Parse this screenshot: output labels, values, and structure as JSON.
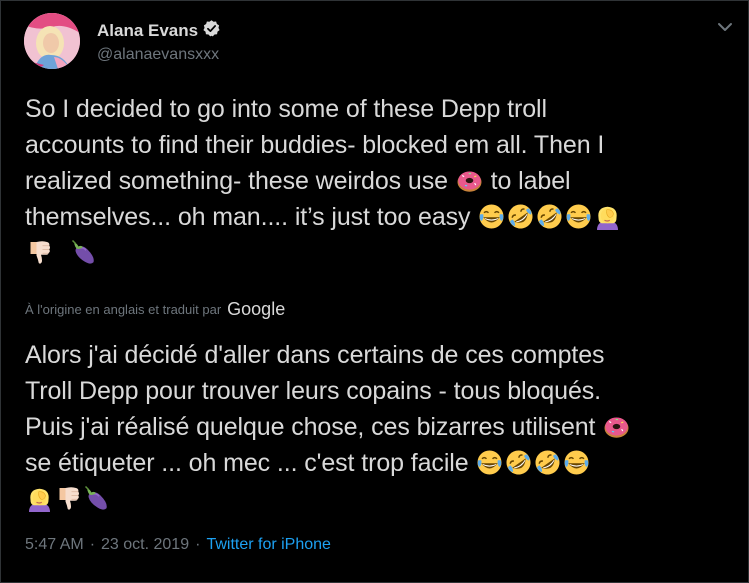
{
  "author": {
    "name": "Alana Evans",
    "handle": "@alanaevansxxx",
    "verified": true
  },
  "tweet": {
    "lines": [
      "So I decided to go into some of these Depp troll",
      "accounts to find their buddies- blocked em all. Then I",
      "realized something- these weirdos use",
      "to label",
      "themselves... oh man.... it’s just too easy"
    ]
  },
  "translation": {
    "label": "À l'origine en anglais et traduit par",
    "provider": "Google",
    "lines": [
      "Alors j'ai décidé d'aller dans certains de ces comptes",
      "Troll Depp pour trouver leurs copains - tous bloqués.",
      "Puis j'ai réalisé quelque chose, ces bizarres utilisent",
      "se étiqueter ... oh mec ... c'est trop facile"
    ]
  },
  "meta": {
    "time": "5:47 AM",
    "separator": "·",
    "date": "23 oct. 2019",
    "source": "Twitter for iPhone"
  },
  "icons": {
    "verified": "verified-badge-icon",
    "menu": "chevron-down-icon",
    "donut": "donut-emoji",
    "laugh": "tears-of-joy-emoji",
    "rofl": "rolling-on-floor-laughing-emoji",
    "facepalm": "facepalm-emoji",
    "thumbsdown": "thumbs-down-emoji",
    "eggplant": "eggplant-emoji"
  },
  "colors": {
    "background": "#000000",
    "text": "#d9d9d9",
    "secondary": "#6e767d",
    "link": "#1da1f2",
    "verified": "#d9d9d9"
  }
}
